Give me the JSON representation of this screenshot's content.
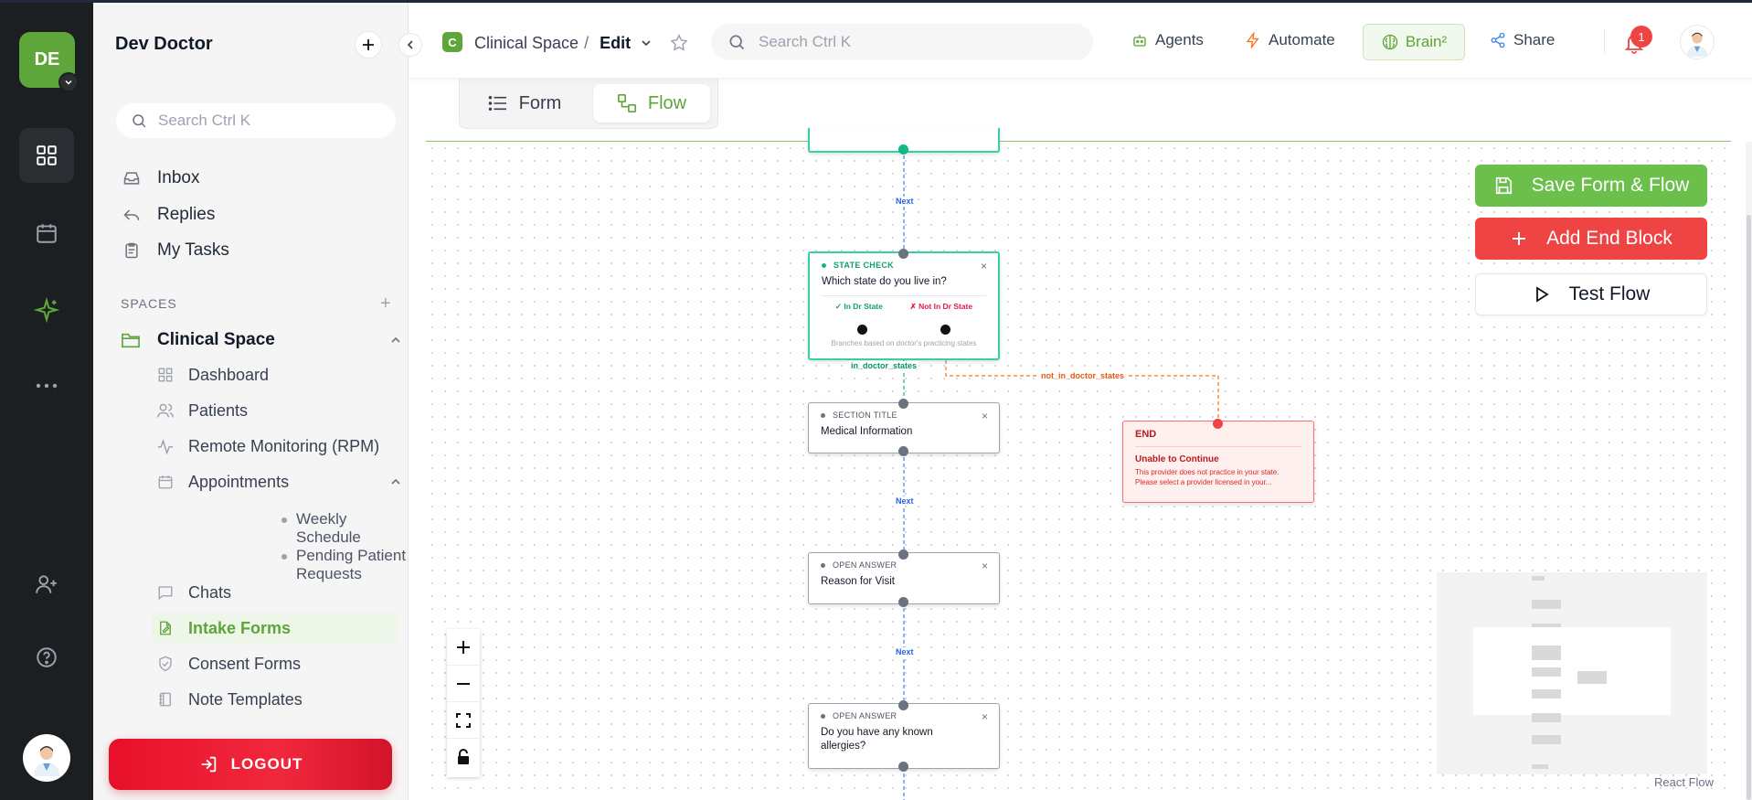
{
  "rail": {
    "workspace_initials": "DE",
    "items": [
      "grid-icon",
      "calendar-icon",
      "sparkle-icon",
      "more-icon",
      "add-user-icon",
      "help-icon"
    ]
  },
  "sidebar": {
    "title": "Dev Doctor",
    "search_placeholder": "Search Ctrl K",
    "inbox": "Inbox",
    "replies": "Replies",
    "my_tasks": "My Tasks",
    "spaces_label": "SPACES",
    "space_name": "Clinical Space",
    "items": {
      "dashboard": "Dashboard",
      "patients": "Patients",
      "rpm": "Remote Monitoring (RPM)",
      "appointments": "Appointments",
      "weekly": "Weekly Schedule",
      "pending": "Pending Patient Requests",
      "chats": "Chats",
      "intake": "Intake Forms",
      "consent": "Consent Forms",
      "notes": "Note Templates"
    },
    "logout": "LOGOUT"
  },
  "topbar": {
    "badge": "C",
    "space": "Clinical Space",
    "separator": "/",
    "mode": "Edit",
    "search_placeholder": "Search Ctrl K",
    "agents": "Agents",
    "automate": "Automate",
    "brain": "Brain²",
    "share": "Share",
    "notifications": "1"
  },
  "tabs": {
    "form": "Form",
    "flow": "Flow"
  },
  "actions": {
    "save": "Save Form & Flow",
    "add_end": "Add End Block",
    "test": "Test Flow"
  },
  "flow": {
    "edge_next": "Next",
    "edge_in": "in_doctor_states",
    "edge_out": "not_in_doctor_states",
    "state_node": {
      "category": "STATE CHECK",
      "question": "Which state do you live in?",
      "opt_in": "✓ In Dr State",
      "opt_out": "✗ Not In Dr State",
      "footer": "Branches based on doctor's practicing states"
    },
    "section_node": {
      "category": "SECTION TITLE",
      "question": "Medical Information"
    },
    "open1": {
      "category": "OPEN ANSWER",
      "question": "Reason for Visit"
    },
    "open2": {
      "category": "OPEN ANSWER",
      "question": "Do you have any known allergies?"
    },
    "end_node": {
      "title": "END",
      "heading": "Unable to Continue",
      "desc1": "This provider does not practice in your state.",
      "desc2": "Please select a provider licensed in your..."
    },
    "close_symbol": "×"
  },
  "attribution": "React Flow"
}
